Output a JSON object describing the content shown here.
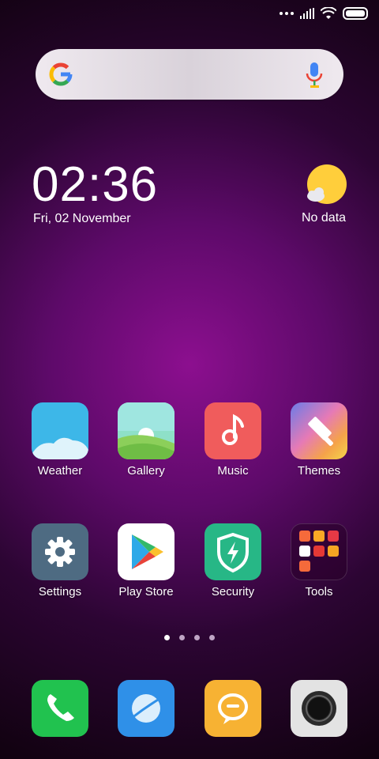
{
  "search": {
    "label": "Google Search"
  },
  "clock": {
    "time": "02:36",
    "date": "Fri, 02 November"
  },
  "weather": {
    "text": "No data"
  },
  "apps": {
    "row1": [
      {
        "label": "Weather"
      },
      {
        "label": "Gallery"
      },
      {
        "label": "Music"
      },
      {
        "label": "Themes"
      }
    ],
    "row2": [
      {
        "label": "Settings"
      },
      {
        "label": "Play Store"
      },
      {
        "label": "Security"
      },
      {
        "label": "Tools"
      }
    ]
  },
  "pager": {
    "pages": 4,
    "active": 1
  },
  "dock": [
    "Phone",
    "Browser",
    "Messages",
    "Camera"
  ],
  "colors": {
    "weather_tile": "#3db7e8",
    "gallery_tile": "#8ee0c8",
    "music_tile": "#f05c5c",
    "settings_tile": "#4e6b82",
    "security_tile": "#27b786",
    "phone_tile": "#21c24f",
    "browser_tile": "#2f90e8",
    "messages_tile": "#f7b233",
    "camera_tile": "#e3e3e3"
  }
}
